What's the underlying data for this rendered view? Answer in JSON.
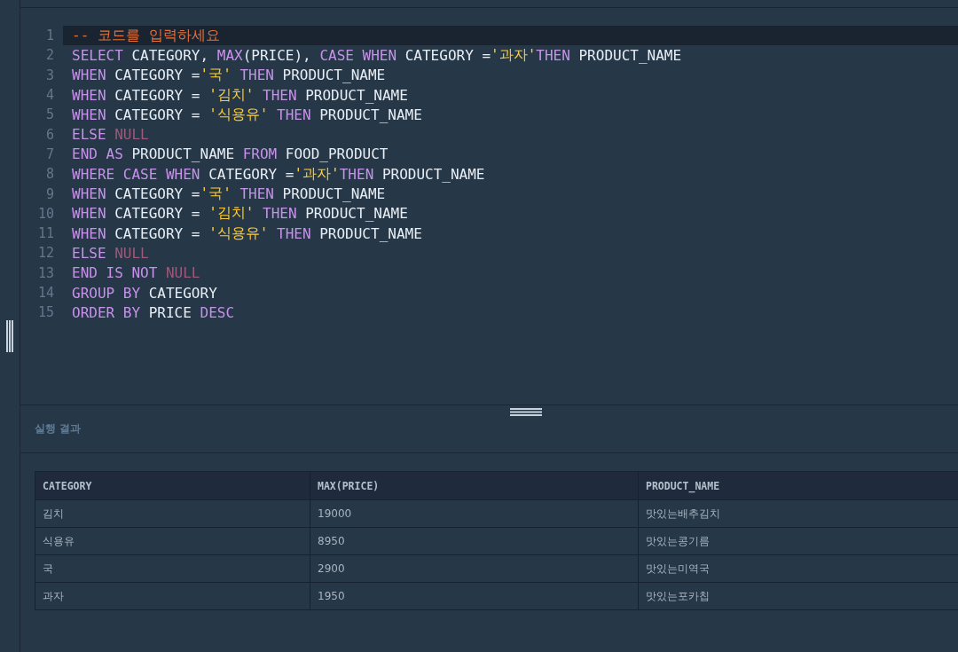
{
  "editor": {
    "lines": [
      {
        "number": "1",
        "current": true,
        "tokens": [
          {
            "kind": "comment",
            "text": "-- 코드를 입력하세요"
          }
        ]
      },
      {
        "number": "2",
        "current": false,
        "tokens": [
          {
            "kind": "keyword",
            "text": "SELECT"
          },
          {
            "kind": "plain",
            "text": " CATEGORY, "
          },
          {
            "kind": "keyword",
            "text": "MAX"
          },
          {
            "kind": "plain",
            "text": "(PRICE), "
          },
          {
            "kind": "keyword",
            "text": "CASE WHEN"
          },
          {
            "kind": "plain",
            "text": " CATEGORY ="
          },
          {
            "kind": "string",
            "text": "'과자'"
          },
          {
            "kind": "keyword",
            "text": "THEN"
          },
          {
            "kind": "plain",
            "text": " PRODUCT_NAME"
          }
        ]
      },
      {
        "number": "3",
        "current": false,
        "tokens": [
          {
            "kind": "keyword",
            "text": "WHEN"
          },
          {
            "kind": "plain",
            "text": " CATEGORY ="
          },
          {
            "kind": "string",
            "text": "'국'"
          },
          {
            "kind": "keyword",
            "text": " THEN"
          },
          {
            "kind": "plain",
            "text": " PRODUCT_NAME"
          }
        ]
      },
      {
        "number": "4",
        "current": false,
        "tokens": [
          {
            "kind": "keyword",
            "text": "WHEN"
          },
          {
            "kind": "plain",
            "text": " CATEGORY = "
          },
          {
            "kind": "string",
            "text": "'김치'"
          },
          {
            "kind": "keyword",
            "text": " THEN"
          },
          {
            "kind": "plain",
            "text": " PRODUCT_NAME"
          }
        ]
      },
      {
        "number": "5",
        "current": false,
        "tokens": [
          {
            "kind": "keyword",
            "text": "WHEN"
          },
          {
            "kind": "plain",
            "text": " CATEGORY = "
          },
          {
            "kind": "string",
            "text": "'식용유'"
          },
          {
            "kind": "keyword",
            "text": " THEN"
          },
          {
            "kind": "plain",
            "text": " PRODUCT_NAME"
          }
        ]
      },
      {
        "number": "6",
        "current": false,
        "tokens": [
          {
            "kind": "keyword",
            "text": "ELSE"
          },
          {
            "kind": "null",
            "text": " NULL"
          }
        ]
      },
      {
        "number": "7",
        "current": false,
        "tokens": [
          {
            "kind": "keyword",
            "text": "END AS"
          },
          {
            "kind": "plain",
            "text": " PRODUCT_NAME "
          },
          {
            "kind": "keyword",
            "text": "FROM"
          },
          {
            "kind": "plain",
            "text": " FOOD_PRODUCT"
          }
        ]
      },
      {
        "number": "8",
        "current": false,
        "tokens": [
          {
            "kind": "keyword",
            "text": "WHERE CASE WHEN"
          },
          {
            "kind": "plain",
            "text": " CATEGORY ="
          },
          {
            "kind": "string",
            "text": "'과자'"
          },
          {
            "kind": "keyword",
            "text": "THEN"
          },
          {
            "kind": "plain",
            "text": " PRODUCT_NAME"
          }
        ]
      },
      {
        "number": "9",
        "current": false,
        "tokens": [
          {
            "kind": "keyword",
            "text": "WHEN"
          },
          {
            "kind": "plain",
            "text": " CATEGORY ="
          },
          {
            "kind": "string",
            "text": "'국'"
          },
          {
            "kind": "keyword",
            "text": " THEN"
          },
          {
            "kind": "plain",
            "text": " PRODUCT_NAME"
          }
        ]
      },
      {
        "number": "10",
        "current": false,
        "tokens": [
          {
            "kind": "keyword",
            "text": "WHEN"
          },
          {
            "kind": "plain",
            "text": " CATEGORY = "
          },
          {
            "kind": "string",
            "text": "'김치'"
          },
          {
            "kind": "keyword",
            "text": " THEN"
          },
          {
            "kind": "plain",
            "text": " PRODUCT_NAME"
          }
        ]
      },
      {
        "number": "11",
        "current": false,
        "tokens": [
          {
            "kind": "keyword",
            "text": "WHEN"
          },
          {
            "kind": "plain",
            "text": " CATEGORY = "
          },
          {
            "kind": "string",
            "text": "'식용유'"
          },
          {
            "kind": "keyword",
            "text": " THEN"
          },
          {
            "kind": "plain",
            "text": " PRODUCT_NAME"
          }
        ]
      },
      {
        "number": "12",
        "current": false,
        "tokens": [
          {
            "kind": "keyword",
            "text": "ELSE"
          },
          {
            "kind": "null",
            "text": " NULL"
          }
        ]
      },
      {
        "number": "13",
        "current": false,
        "tokens": [
          {
            "kind": "keyword",
            "text": "END IS NOT"
          },
          {
            "kind": "null",
            "text": " NULL"
          }
        ]
      },
      {
        "number": "14",
        "current": false,
        "tokens": [
          {
            "kind": "keyword",
            "text": "GROUP BY"
          },
          {
            "kind": "plain",
            "text": " CATEGORY"
          }
        ]
      },
      {
        "number": "15",
        "current": false,
        "tokens": [
          {
            "kind": "keyword",
            "text": "ORDER BY"
          },
          {
            "kind": "plain",
            "text": " PRICE "
          },
          {
            "kind": "keyword",
            "text": "DESC"
          }
        ]
      }
    ]
  },
  "results": {
    "title": "실행 결과",
    "columns": [
      "CATEGORY",
      "MAX(PRICE)",
      "PRODUCT_NAME"
    ],
    "rows": [
      [
        "김치",
        "19000",
        "맛있는배추김치"
      ],
      [
        "식용유",
        "8950",
        "맛있는콩기름"
      ],
      [
        "국",
        "2900",
        "맛있는미역국"
      ],
      [
        "과자",
        "1950",
        "맛있는포카칩"
      ]
    ]
  }
}
